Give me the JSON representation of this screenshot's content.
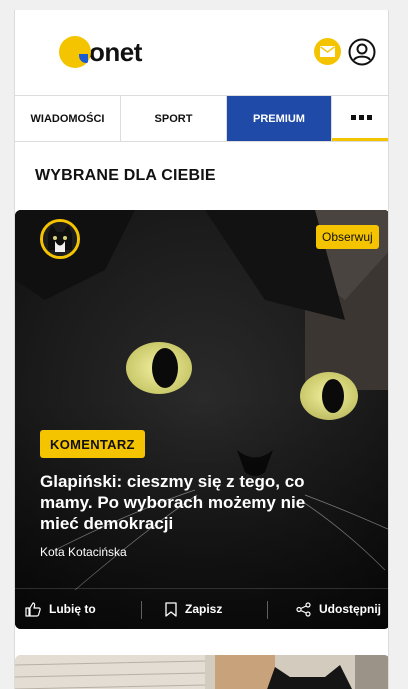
{
  "header": {
    "logo_text": "onet",
    "mail_icon": "envelope-icon",
    "user_icon": "user-icon"
  },
  "nav": {
    "items": [
      {
        "label": "WIADOMOŚCI"
      },
      {
        "label": "SPORT"
      },
      {
        "label": "PREMIUM"
      }
    ],
    "more_icon": "more-dots-icon"
  },
  "section": {
    "title": "WYBRANE DLA CIEBIE"
  },
  "card": {
    "follow_label": "Obserwuj",
    "tag": "KOMENTARZ",
    "headline": "Glapiński: cieszmy się z tego, co mamy. Po wyborach możemy nie mieć demokracji",
    "author": "Kota Kotacińska",
    "actions": {
      "like": "Lubię to",
      "save": "Zapisz",
      "share": "Udostępnij"
    }
  },
  "colors": {
    "accent": "#f5c400",
    "premium": "#1f4aa8"
  }
}
